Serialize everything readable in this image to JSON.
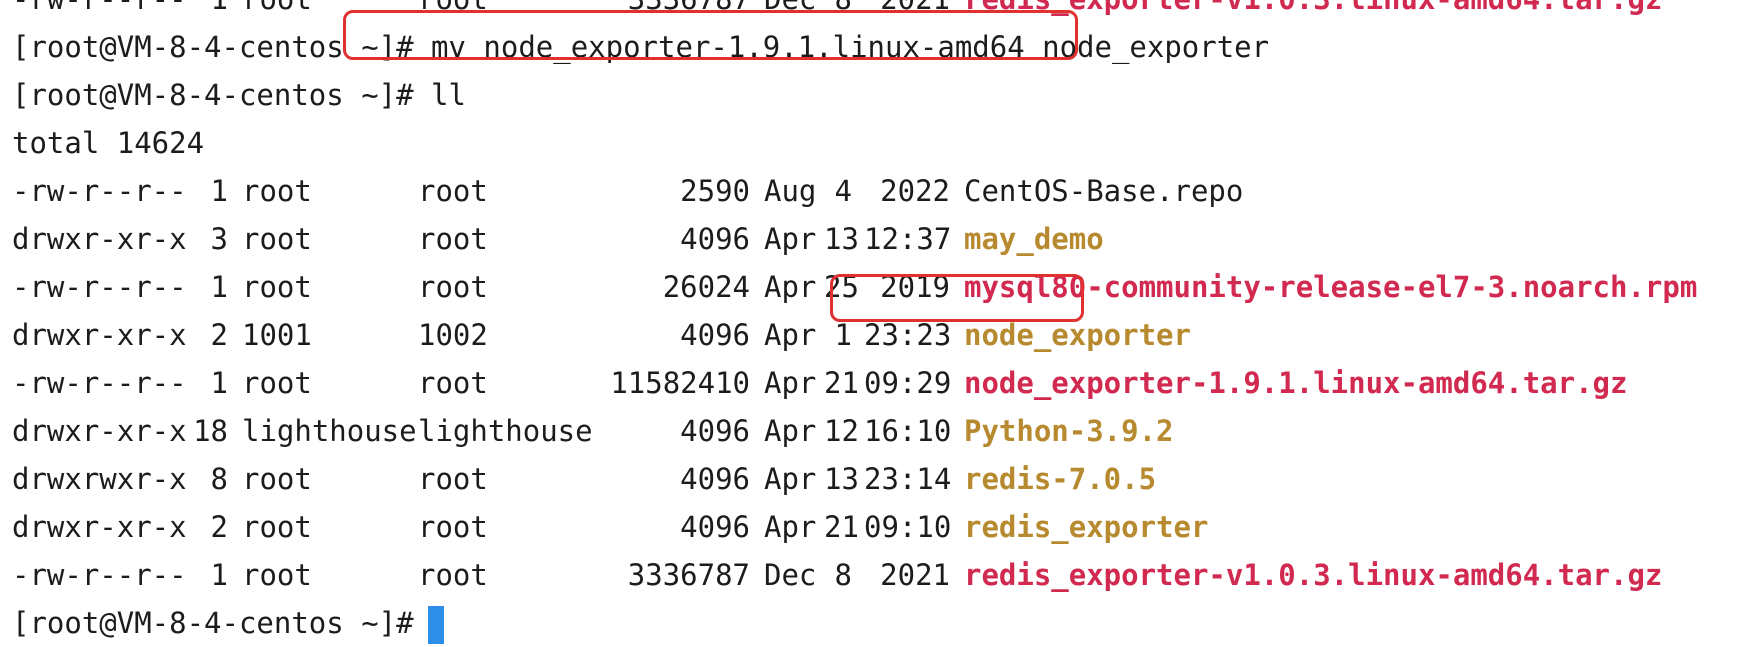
{
  "terminal": {
    "prompt": "[root@VM-8-4-centos ~]#",
    "partial_top_line": {
      "perm": "-rw-r--r--",
      "links": "1",
      "owner": "root",
      "group": "root",
      "size": "3336787",
      "month": "Dec",
      "day": "8",
      "time_or_year": "2021",
      "name": "redis_exporter-v1.0.3.linux-amd64.tar.gz"
    },
    "command_1": "mv node_exporter-1.9.1.linux-amd64 node_exporter",
    "command_2": "ll",
    "total_line": "total 14624",
    "listing": [
      {
        "perm": "-rw-r--r--",
        "links": "1",
        "owner": "root",
        "group": "root",
        "size": "2590",
        "month": "Aug",
        "day": "4",
        "time_or_year": "2022",
        "name": "CentOS-Base.repo",
        "kind": "plain"
      },
      {
        "perm": "drwxr-xr-x",
        "links": "3",
        "owner": "root",
        "group": "root",
        "size": "4096",
        "month": "Apr",
        "day": "13",
        "time_or_year": "12:37",
        "name": "may_demo",
        "kind": "dir"
      },
      {
        "perm": "-rw-r--r--",
        "links": "1",
        "owner": "root",
        "group": "root",
        "size": "26024",
        "month": "Apr",
        "day": "25",
        "time_or_year": "2019",
        "name": "mysql80-community-release-el7-3.noarch.rpm",
        "kind": "archive"
      },
      {
        "perm": "drwxr-xr-x",
        "links": "2",
        "owner": "1001",
        "group": "1002",
        "size": "4096",
        "month": "Apr",
        "day": "1",
        "time_or_year": "23:23",
        "name": "node_exporter",
        "kind": "dir"
      },
      {
        "perm": "-rw-r--r--",
        "links": "1",
        "owner": "root",
        "group": "root",
        "size": "11582410",
        "month": "Apr",
        "day": "21",
        "time_or_year": "09:29",
        "name": "node_exporter-1.9.1.linux-amd64.tar.gz",
        "kind": "archive"
      },
      {
        "perm": "drwxr-xr-x",
        "links": "18",
        "owner": "lighthouse",
        "group": "lighthouse",
        "size": "4096",
        "month": "Apr",
        "day": "12",
        "time_or_year": "16:10",
        "name": "Python-3.9.2",
        "kind": "dir"
      },
      {
        "perm": "drwxrwxr-x",
        "links": "8",
        "owner": "root",
        "group": "root",
        "size": "4096",
        "month": "Apr",
        "day": "13",
        "time_or_year": "23:14",
        "name": "redis-7.0.5",
        "kind": "dir"
      },
      {
        "perm": "drwxr-xr-x",
        "links": "2",
        "owner": "root",
        "group": "root",
        "size": "4096",
        "month": "Apr",
        "day": "21",
        "time_or_year": "09:10",
        "name": "redis_exporter",
        "kind": "dir"
      },
      {
        "perm": "-rw-r--r--",
        "links": "1",
        "owner": "root",
        "group": "root",
        "size": "3336787",
        "month": "Dec",
        "day": "8",
        "time_or_year": "2021",
        "name": "redis_exporter-v1.0.3.linux-amd64.tar.gz",
        "kind": "archive"
      }
    ],
    "colors": {
      "directory": "#b78a2f",
      "archive": "#d1294f",
      "text": "#1c1c1c",
      "cursor": "#2f8fe8",
      "highlight": "#e03030"
    }
  }
}
